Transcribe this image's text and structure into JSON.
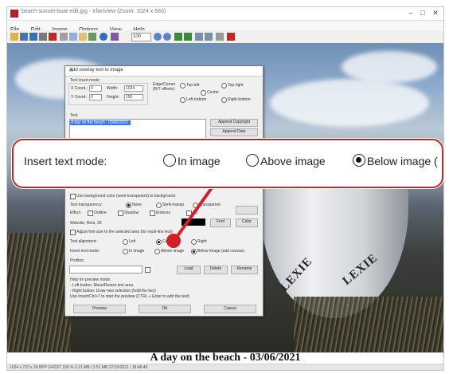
{
  "window": {
    "title": "beach-sunset-boat-edit.jpg - IrfanView (Zoom: 1024 x 683)",
    "minimize": "–",
    "maximize": "□",
    "close": "✕"
  },
  "menu": [
    "File",
    "Edit",
    "Image",
    "Options",
    "View",
    "Help"
  ],
  "toolbar": {
    "zoom_value": "100"
  },
  "dialog": {
    "title": "Add overlay text to image",
    "text_rect_label": "Text insert mode:",
    "x_label": "X Coord.:",
    "x_value": "0",
    "y_label": "Y Coord.:",
    "y_value": "0",
    "width_label": "Width:",
    "width_value": "1024",
    "height_label": "Height:",
    "height_value": "150",
    "edge_label": "Edge/Corner",
    "edge_note": "(R/T offsets)",
    "opt_top_left": "Top-left",
    "opt_top_right": "Top-right",
    "opt_center": "Center",
    "opt_bottom_left": "Left-bottom",
    "opt_bottom_right": "Right-bottom",
    "text_label": "Text:",
    "text_value": "A day on the beach - 03/06/2021",
    "append_copyright": "Append Copyright",
    "append_date": "Append Date",
    "background_label": "Use background color (semi-transparent) to background",
    "transparency_label": "Text transparency:",
    "trans_none": "None",
    "trans_semi": "Semi-transp.",
    "trans_full": "Transparent",
    "effect_label": "Effect:",
    "effect_outline": "Outline",
    "effect_shadow": "Shadow",
    "effect_emboss": "Emboss",
    "effect_3d": "3D",
    "font_label": "Website, Rem, 25",
    "font_button": "Font",
    "color_button": "Color",
    "adjust_label": "Adjust font size to the selected area (for multi-line text)",
    "alignment_label": "Text alignment:",
    "align_left": "Left",
    "align_center": "Center",
    "align_right": "Right",
    "insert_mode_label": "Insert text mode:",
    "mode_in": "In image",
    "mode_above": "Above image",
    "mode_below": "Below image (add canvas)",
    "profiles_label": "Profiles:",
    "save_button": "Load",
    "delete_button": "Delete",
    "rename_button": "Rename",
    "help_title": "Help for preview mode:",
    "help_line1": "- Left button: Move/Resize text area",
    "help_line2": "- Right button: Draw new selection (hold the key)",
    "help_line3": "Use Insert/Ctrl+T to start the preview (CTRL + Enter to add the text)",
    "preview_button": "Preview",
    "ok_button": "OK",
    "cancel_button": "Cancel"
  },
  "callout": {
    "label": "Insert text mode:",
    "opt_in": "In image",
    "opt_above": "Above image",
    "opt_below": "Below image ("
  },
  "image_text": {
    "boat_name_left": "LEXIE",
    "boat_name_right": "LEXIE",
    "caption": "A day on the beach - 03/06/2021"
  },
  "statusbar": {
    "text": "1024 x 723 x 24 BPP   1/4/227   100 %   3.21 MB / 2.51 MB   27/10/2021 / 18:46:40"
  },
  "colors": {
    "callout_border": "#c0272d",
    "pointer": "#d0202a",
    "selection": "#3875d7"
  }
}
